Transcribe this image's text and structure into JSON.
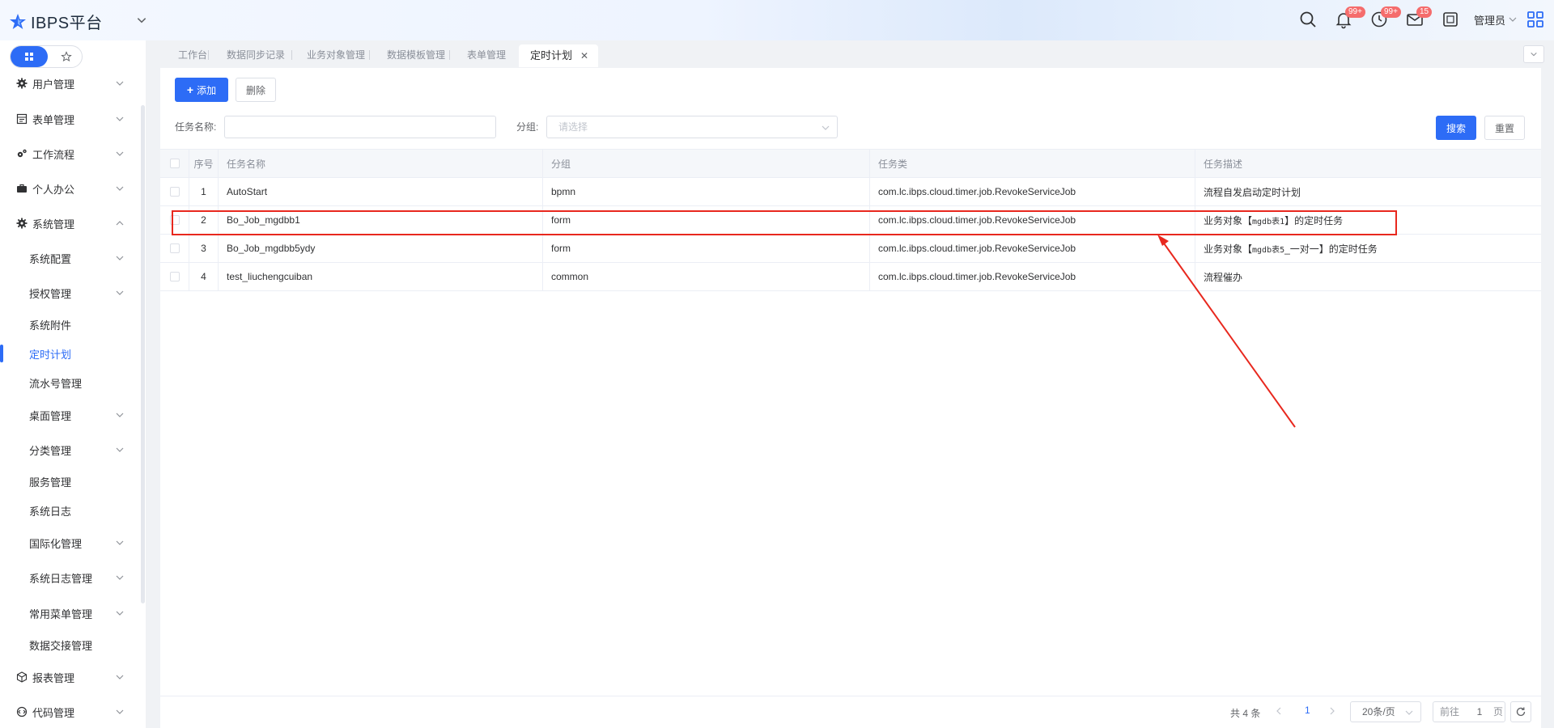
{
  "header": {
    "app_title": "IBPS平台",
    "notifications_badge": "99+",
    "reminders_badge": "99+",
    "messages_badge": "15",
    "username": "管理员"
  },
  "sidebar": {
    "items": [
      {
        "label": "用户管理",
        "icon": "gear-icon"
      },
      {
        "label": "表单管理",
        "icon": "form-icon"
      },
      {
        "label": "工作流程",
        "icon": "gears-icon"
      },
      {
        "label": "个人办公",
        "icon": "briefcase-icon"
      },
      {
        "label": "系统管理",
        "icon": "gear-icon"
      },
      {
        "label": "系统配置"
      },
      {
        "label": "授权管理"
      },
      {
        "label": "系统附件"
      },
      {
        "label": "定时计划"
      },
      {
        "label": "流水号管理"
      },
      {
        "label": "桌面管理"
      },
      {
        "label": "分类管理"
      },
      {
        "label": "服务管理"
      },
      {
        "label": "系统日志"
      },
      {
        "label": "国际化管理"
      },
      {
        "label": "系统日志管理"
      },
      {
        "label": "常用菜单管理"
      },
      {
        "label": "数据交接管理"
      },
      {
        "label": "报表管理",
        "icon": "cube-icon"
      },
      {
        "label": "代码管理",
        "icon": "code-icon"
      }
    ]
  },
  "tabs": [
    {
      "label": "工作台"
    },
    {
      "label": "数据同步记录"
    },
    {
      "label": "业务对象管理"
    },
    {
      "label": "数据模板管理"
    },
    {
      "label": "表单管理"
    },
    {
      "label": "定时计划",
      "active": true
    }
  ],
  "toolbar": {
    "add_label": "添加",
    "delete_label": "删除",
    "search_label": "搜索",
    "reset_label": "重置"
  },
  "filters": {
    "task_name_label": "任务名称:",
    "task_name_value": "",
    "group_label": "分组:",
    "group_placeholder": "请选择"
  },
  "table": {
    "columns": [
      "序号",
      "任务名称",
      "分组",
      "任务类",
      "任务描述"
    ],
    "rows": [
      {
        "no": "1",
        "name": "AutoStart",
        "group": "bpmn",
        "class": "com.lc.ibps.cloud.timer.job.RevokeServiceJob",
        "desc": "流程自发启动定时计划"
      },
      {
        "no": "2",
        "name": "Bo_Job_mgdbb1",
        "group": "form",
        "class": "com.lc.ibps.cloud.timer.job.RevokeServiceJob",
        "desc_pre": "业务对象【",
        "desc_code": "mgdb表1",
        "desc_post": "】的定时任务"
      },
      {
        "no": "3",
        "name": "Bo_Job_mgdbb5ydy",
        "group": "form",
        "class": "com.lc.ibps.cloud.timer.job.RevokeServiceJob",
        "desc_pre": "业务对象【",
        "desc_code": "mgdb表5",
        "desc_post": "_一对一】的定时任务"
      },
      {
        "no": "4",
        "name": "test_liuchengcuiban",
        "group": "common",
        "class": "com.lc.ibps.cloud.timer.job.RevokeServiceJob",
        "desc": "流程催办"
      }
    ]
  },
  "pagination": {
    "total": "共 4 条",
    "current_page": "1",
    "page_size": "20条/页",
    "goto_prefix": "前往",
    "goto_value": "1",
    "goto_suffix": "页"
  },
  "colors": {
    "primary": "#2d6cf6",
    "badge": "#f56c6c",
    "annotation": "#e8281e"
  }
}
